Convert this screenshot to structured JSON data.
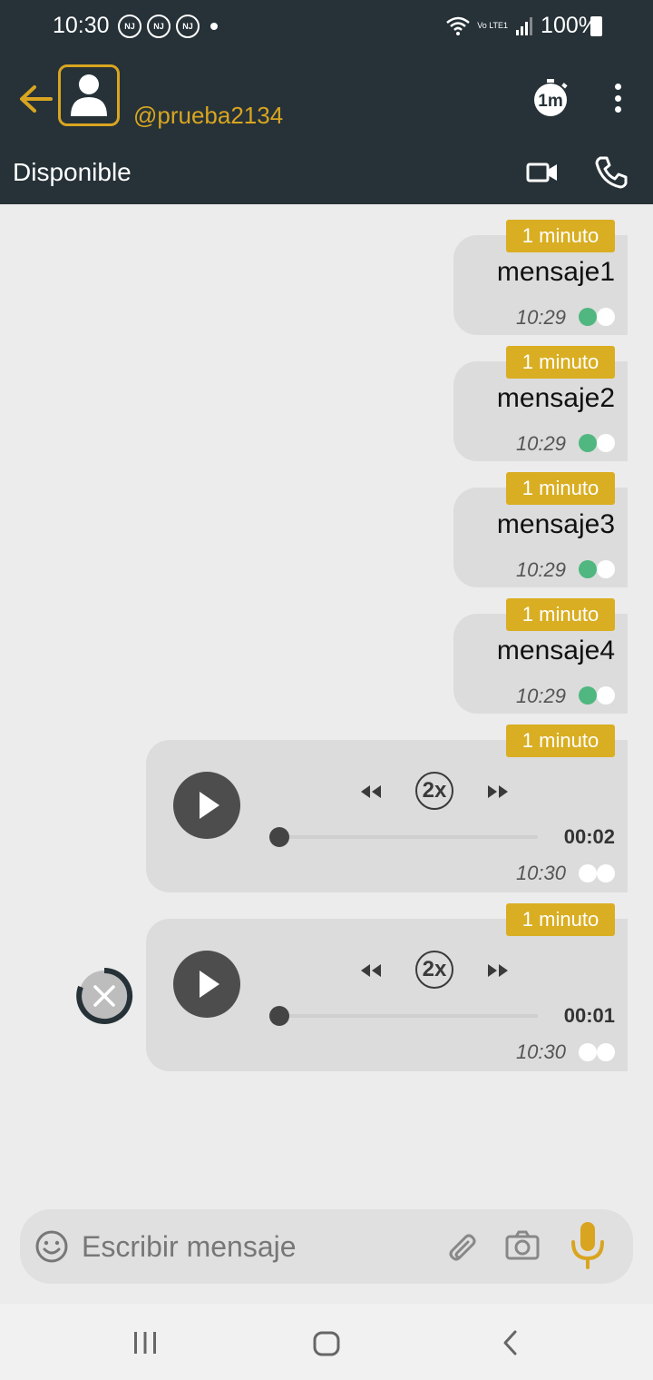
{
  "status_bar": {
    "time": "10:30",
    "notifications": [
      "NJ",
      "NJ",
      "NJ"
    ],
    "network": "Vo LTE1",
    "battery": "100%"
  },
  "header": {
    "username": "@prueba2134",
    "presence": "Disponible",
    "timer_icon_label": "1m"
  },
  "messages": [
    {
      "type": "text",
      "timer": "1 minuto",
      "text": "mensaje1",
      "time": "10:29",
      "status": "green-white"
    },
    {
      "type": "text",
      "timer": "1 minuto",
      "text": "mensaje2",
      "time": "10:29",
      "status": "green-white"
    },
    {
      "type": "text",
      "timer": "1 minuto",
      "text": "mensaje3",
      "time": "10:29",
      "status": "green-white"
    },
    {
      "type": "text",
      "timer": "1 minuto",
      "text": "mensaje4",
      "time": "10:29",
      "status": "green-white"
    },
    {
      "type": "audio",
      "timer": "1 minuto",
      "speed": "2x",
      "duration": "00:02",
      "time": "10:30",
      "status": "white-white"
    },
    {
      "type": "audio",
      "timer": "1 minuto",
      "speed": "2x",
      "duration": "00:01",
      "time": "10:30",
      "status": "white-white"
    }
  ],
  "composer": {
    "placeholder": "Escribir mensaje"
  },
  "colors": {
    "header_bg": "#263238",
    "accent": "#d9a520",
    "badge": "#d9ae22",
    "delivered": "#4fb77f",
    "chat_bg": "#ececec",
    "bubble": "#dcdcdc"
  },
  "icons": [
    "back-arrow-icon",
    "avatar-icon",
    "timer-icon",
    "more-vert-icon",
    "video-call-icon",
    "phone-icon",
    "play-icon",
    "rewind-icon",
    "fast-forward-icon",
    "cancel-icon",
    "emoji-icon",
    "attach-icon",
    "camera-icon",
    "mic-icon"
  ]
}
